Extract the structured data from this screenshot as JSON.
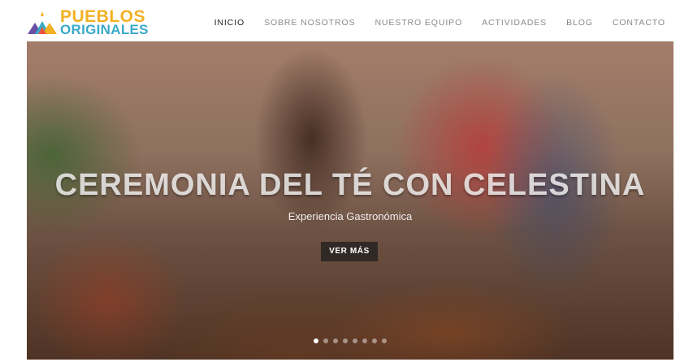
{
  "brand": {
    "line1": "PUEBLOS",
    "line2": "ORIGINALES",
    "colors": {
      "yellow": "#f2b124",
      "blue": "#3aa9c9",
      "red": "#e8553f",
      "purple": "#6a4fa3"
    },
    "icon": "mountains-logo-icon"
  },
  "nav": {
    "items": [
      {
        "label": "INICIO",
        "active": true
      },
      {
        "label": "SOBRE NOSOTROS",
        "active": false
      },
      {
        "label": "NUESTRO EQUIPO",
        "active": false
      },
      {
        "label": "ACTIVIDADES",
        "active": false
      },
      {
        "label": "BLOG",
        "active": false
      },
      {
        "label": "CONTACTO",
        "active": false
      }
    ]
  },
  "hero": {
    "title": "CEREMONIA DEL TÉ CON CELESTINA",
    "subtitle": "Experiencia Gastronómica",
    "cta_label": "VER MÁS",
    "slide_count": 8,
    "active_slide": 1
  }
}
